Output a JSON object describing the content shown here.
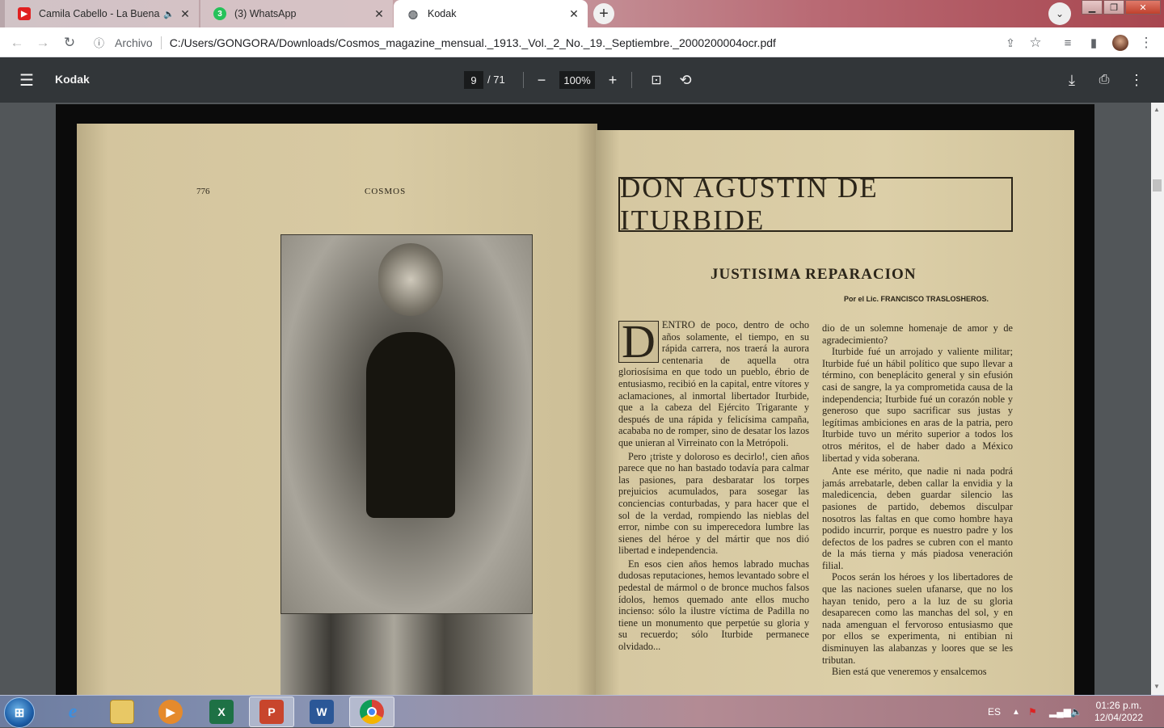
{
  "tabs": [
    {
      "title": "Camila Cabello - La Buena Vi",
      "favicon": "youtube-icon",
      "audio": "🔈"
    },
    {
      "title": "(3) WhatsApp",
      "favicon": "whatsapp-icon",
      "badge": "3"
    },
    {
      "title": "Kodak",
      "favicon": "globe-icon"
    }
  ],
  "address": {
    "scheme_label": "Archivo",
    "url": "C:/Users/GONGORA/Downloads/Cosmos_magazine_mensual._1913._Vol._2_No._19._Septiembre._2000200004ocr.pdf"
  },
  "pdf": {
    "title": "Kodak",
    "page_current": "9",
    "page_total": "/ 71",
    "zoom": "100%"
  },
  "document": {
    "left_page_number": "776",
    "left_running_head": "COSMOS",
    "right_title": "DON AGUSTIN DE ITURBIDE",
    "right_subtitle": "JUSTISIMA REPARACION",
    "byline": "Por el Lic. FRANCISCO TRASLOSHEROS.",
    "dropcap": "D",
    "col1_p1": "ENTRO de poco, dentro de ocho años solamente, el tiempo, en su rápida carrera, nos traerá la aurora centenaria de aquella otra gloriosísima en que todo un pueblo, ébrio de entusiasmo, recibió en la capital, entre vítores y aclamaciones, al inmortal libertador Iturbide, que a la cabeza del Ejército Trigarante y después de una rápida y felicísima campaña, acababa no de romper, sino de desatar los lazos que unieran al Virreinato con la Metrópoli.",
    "col1_p2": "Pero ¡triste y doloroso es decirlo!, cien años parece que no han bastado todavía para calmar las pasiones, para desbaratar los torpes prejuicios acumulados, para sosegar las conciencias conturbadas, y para hacer que el sol de la verdad, rompiendo las nieblas del error, nimbe con su imperecedora lumbre las sienes del héroe y del mártir que nos dió libertad e independencia.",
    "col1_p3": "En esos cien años hemos labrado muchas dudosas reputaciones, hemos levantado sobre el pedestal de mármol o de bronce muchos falsos ídolos, hemos quemado ante ellos mucho incienso: sólo la ilustre víctima de Padilla no tiene un monumento que perpetúe su gloria y su recuerdo; sólo Iturbide permanece olvidado...",
    "col2_p1": "dio de un solemne homenaje de amor y de agradecimiento?",
    "col2_p2": "Iturbide fué un arrojado y valiente militar; Iturbide fué un hábil político que supo llevar a término, con beneplácito general y sin efusión casi de sangre, la ya comprometida causa de la independencia; Iturbide fué un corazón noble y generoso que supo sacrificar sus justas y legítimas ambiciones en aras de la patria, pero Iturbide tuvo un mérito superior a todos los otros méritos, el de haber dado a México libertad y vida soberana.",
    "col2_p3": "Ante ese mérito, que nadie ni nada podrá jamás arrebatarle, deben callar la envidia y la maledicencia, deben guardar silencio las pasiones de partido, debemos disculpar nosotros las faltas en que como hombre haya podido incurrir, porque es nuestro padre y los defectos de los padres se cubren con el manto de la más tierna y más piadosa veneración filial.",
    "col2_p4": "Pocos serán los héroes y los libertadores de que las naciones suelen ufanarse, que no los hayan tenido, pero a la luz de su gloria desaparecen como las manchas del sol, y en nada amenguan el fervoroso entusiasmo que por ellos se experimenta, ni entibian ni disminuyen las alabanzas y loores que se les tributan.",
    "col2_p5": "Bien está que veneremos y ensalcemos"
  },
  "taskbar": {
    "apps": [
      "internet-explorer-icon",
      "file-explorer-icon",
      "media-player-icon",
      "excel-icon",
      "powerpoint-icon",
      "word-icon",
      "chrome-icon"
    ],
    "lang": "ES",
    "time": "01:26 p.m.",
    "date": "12/04/2022"
  }
}
